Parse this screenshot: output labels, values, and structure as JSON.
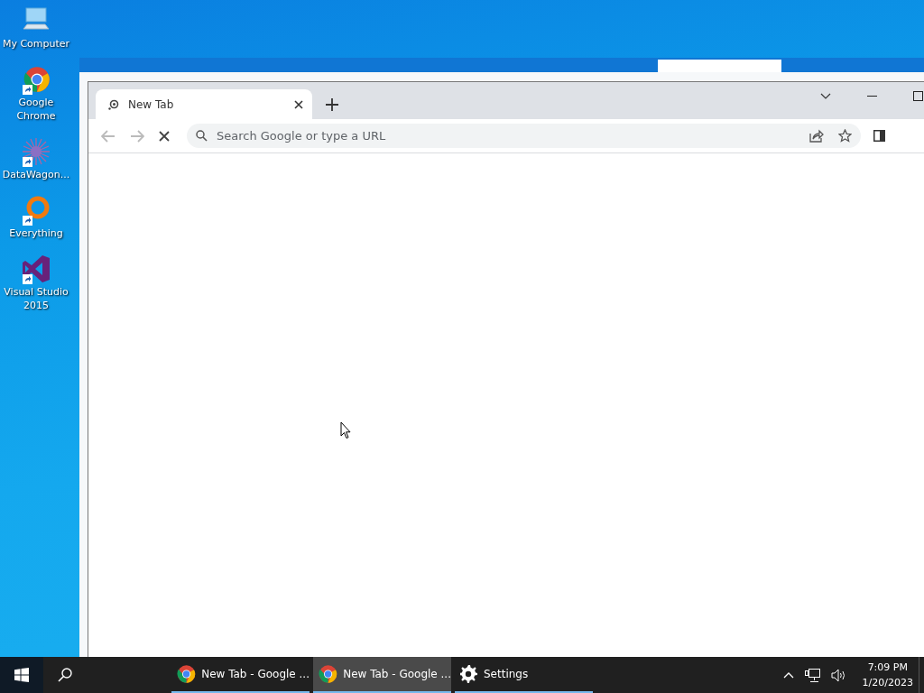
{
  "desktop_icons": [
    {
      "label": "My Computer",
      "kind": "computer"
    },
    {
      "label": "Google Chrome",
      "kind": "chrome"
    },
    {
      "label": "DataWagon...",
      "kind": "datawagon"
    },
    {
      "label": "Everything",
      "kind": "everything"
    },
    {
      "label": "Visual Studio 2015",
      "kind": "vs"
    }
  ],
  "browser": {
    "tabs": [
      {
        "title": "New Tab",
        "selected": true
      }
    ],
    "loading": true,
    "omnibox": {
      "placeholder": "Search Google or type a URL"
    }
  },
  "taskbar": {
    "apps": [
      {
        "label": "New Tab - Google ...",
        "kind": "chrome",
        "selected": false
      },
      {
        "label": "New Tab - Google ...",
        "kind": "chrome",
        "selected": true
      },
      {
        "label": "Settings",
        "kind": "settings",
        "selected": false
      }
    ],
    "clock": {
      "time": "7:09 PM",
      "date": "1/20/2023"
    }
  }
}
